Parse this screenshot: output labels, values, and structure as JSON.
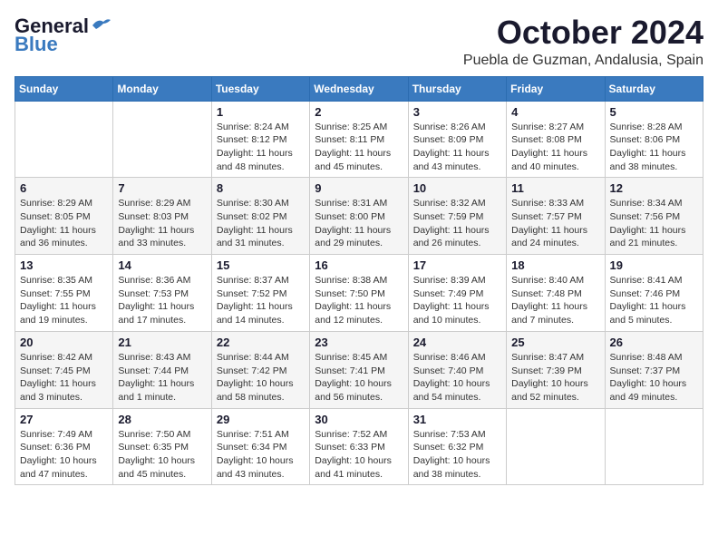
{
  "header": {
    "logo_general": "General",
    "logo_blue": "Blue",
    "month_title": "October 2024",
    "location": "Puebla de Guzman, Andalusia, Spain"
  },
  "days_of_week": [
    "Sunday",
    "Monday",
    "Tuesday",
    "Wednesday",
    "Thursday",
    "Friday",
    "Saturday"
  ],
  "weeks": [
    [
      {
        "day": "",
        "info": ""
      },
      {
        "day": "",
        "info": ""
      },
      {
        "day": "1",
        "info": "Sunrise: 8:24 AM\nSunset: 8:12 PM\nDaylight: 11 hours and 48 minutes."
      },
      {
        "day": "2",
        "info": "Sunrise: 8:25 AM\nSunset: 8:11 PM\nDaylight: 11 hours and 45 minutes."
      },
      {
        "day": "3",
        "info": "Sunrise: 8:26 AM\nSunset: 8:09 PM\nDaylight: 11 hours and 43 minutes."
      },
      {
        "day": "4",
        "info": "Sunrise: 8:27 AM\nSunset: 8:08 PM\nDaylight: 11 hours and 40 minutes."
      },
      {
        "day": "5",
        "info": "Sunrise: 8:28 AM\nSunset: 8:06 PM\nDaylight: 11 hours and 38 minutes."
      }
    ],
    [
      {
        "day": "6",
        "info": "Sunrise: 8:29 AM\nSunset: 8:05 PM\nDaylight: 11 hours and 36 minutes."
      },
      {
        "day": "7",
        "info": "Sunrise: 8:29 AM\nSunset: 8:03 PM\nDaylight: 11 hours and 33 minutes."
      },
      {
        "day": "8",
        "info": "Sunrise: 8:30 AM\nSunset: 8:02 PM\nDaylight: 11 hours and 31 minutes."
      },
      {
        "day": "9",
        "info": "Sunrise: 8:31 AM\nSunset: 8:00 PM\nDaylight: 11 hours and 29 minutes."
      },
      {
        "day": "10",
        "info": "Sunrise: 8:32 AM\nSunset: 7:59 PM\nDaylight: 11 hours and 26 minutes."
      },
      {
        "day": "11",
        "info": "Sunrise: 8:33 AM\nSunset: 7:57 PM\nDaylight: 11 hours and 24 minutes."
      },
      {
        "day": "12",
        "info": "Sunrise: 8:34 AM\nSunset: 7:56 PM\nDaylight: 11 hours and 21 minutes."
      }
    ],
    [
      {
        "day": "13",
        "info": "Sunrise: 8:35 AM\nSunset: 7:55 PM\nDaylight: 11 hours and 19 minutes."
      },
      {
        "day": "14",
        "info": "Sunrise: 8:36 AM\nSunset: 7:53 PM\nDaylight: 11 hours and 17 minutes."
      },
      {
        "day": "15",
        "info": "Sunrise: 8:37 AM\nSunset: 7:52 PM\nDaylight: 11 hours and 14 minutes."
      },
      {
        "day": "16",
        "info": "Sunrise: 8:38 AM\nSunset: 7:50 PM\nDaylight: 11 hours and 12 minutes."
      },
      {
        "day": "17",
        "info": "Sunrise: 8:39 AM\nSunset: 7:49 PM\nDaylight: 11 hours and 10 minutes."
      },
      {
        "day": "18",
        "info": "Sunrise: 8:40 AM\nSunset: 7:48 PM\nDaylight: 11 hours and 7 minutes."
      },
      {
        "day": "19",
        "info": "Sunrise: 8:41 AM\nSunset: 7:46 PM\nDaylight: 11 hours and 5 minutes."
      }
    ],
    [
      {
        "day": "20",
        "info": "Sunrise: 8:42 AM\nSunset: 7:45 PM\nDaylight: 11 hours and 3 minutes."
      },
      {
        "day": "21",
        "info": "Sunrise: 8:43 AM\nSunset: 7:44 PM\nDaylight: 11 hours and 1 minute."
      },
      {
        "day": "22",
        "info": "Sunrise: 8:44 AM\nSunset: 7:42 PM\nDaylight: 10 hours and 58 minutes."
      },
      {
        "day": "23",
        "info": "Sunrise: 8:45 AM\nSunset: 7:41 PM\nDaylight: 10 hours and 56 minutes."
      },
      {
        "day": "24",
        "info": "Sunrise: 8:46 AM\nSunset: 7:40 PM\nDaylight: 10 hours and 54 minutes."
      },
      {
        "day": "25",
        "info": "Sunrise: 8:47 AM\nSunset: 7:39 PM\nDaylight: 10 hours and 52 minutes."
      },
      {
        "day": "26",
        "info": "Sunrise: 8:48 AM\nSunset: 7:37 PM\nDaylight: 10 hours and 49 minutes."
      }
    ],
    [
      {
        "day": "27",
        "info": "Sunrise: 7:49 AM\nSunset: 6:36 PM\nDaylight: 10 hours and 47 minutes."
      },
      {
        "day": "28",
        "info": "Sunrise: 7:50 AM\nSunset: 6:35 PM\nDaylight: 10 hours and 45 minutes."
      },
      {
        "day": "29",
        "info": "Sunrise: 7:51 AM\nSunset: 6:34 PM\nDaylight: 10 hours and 43 minutes."
      },
      {
        "day": "30",
        "info": "Sunrise: 7:52 AM\nSunset: 6:33 PM\nDaylight: 10 hours and 41 minutes."
      },
      {
        "day": "31",
        "info": "Sunrise: 7:53 AM\nSunset: 6:32 PM\nDaylight: 10 hours and 38 minutes."
      },
      {
        "day": "",
        "info": ""
      },
      {
        "day": "",
        "info": ""
      }
    ]
  ]
}
